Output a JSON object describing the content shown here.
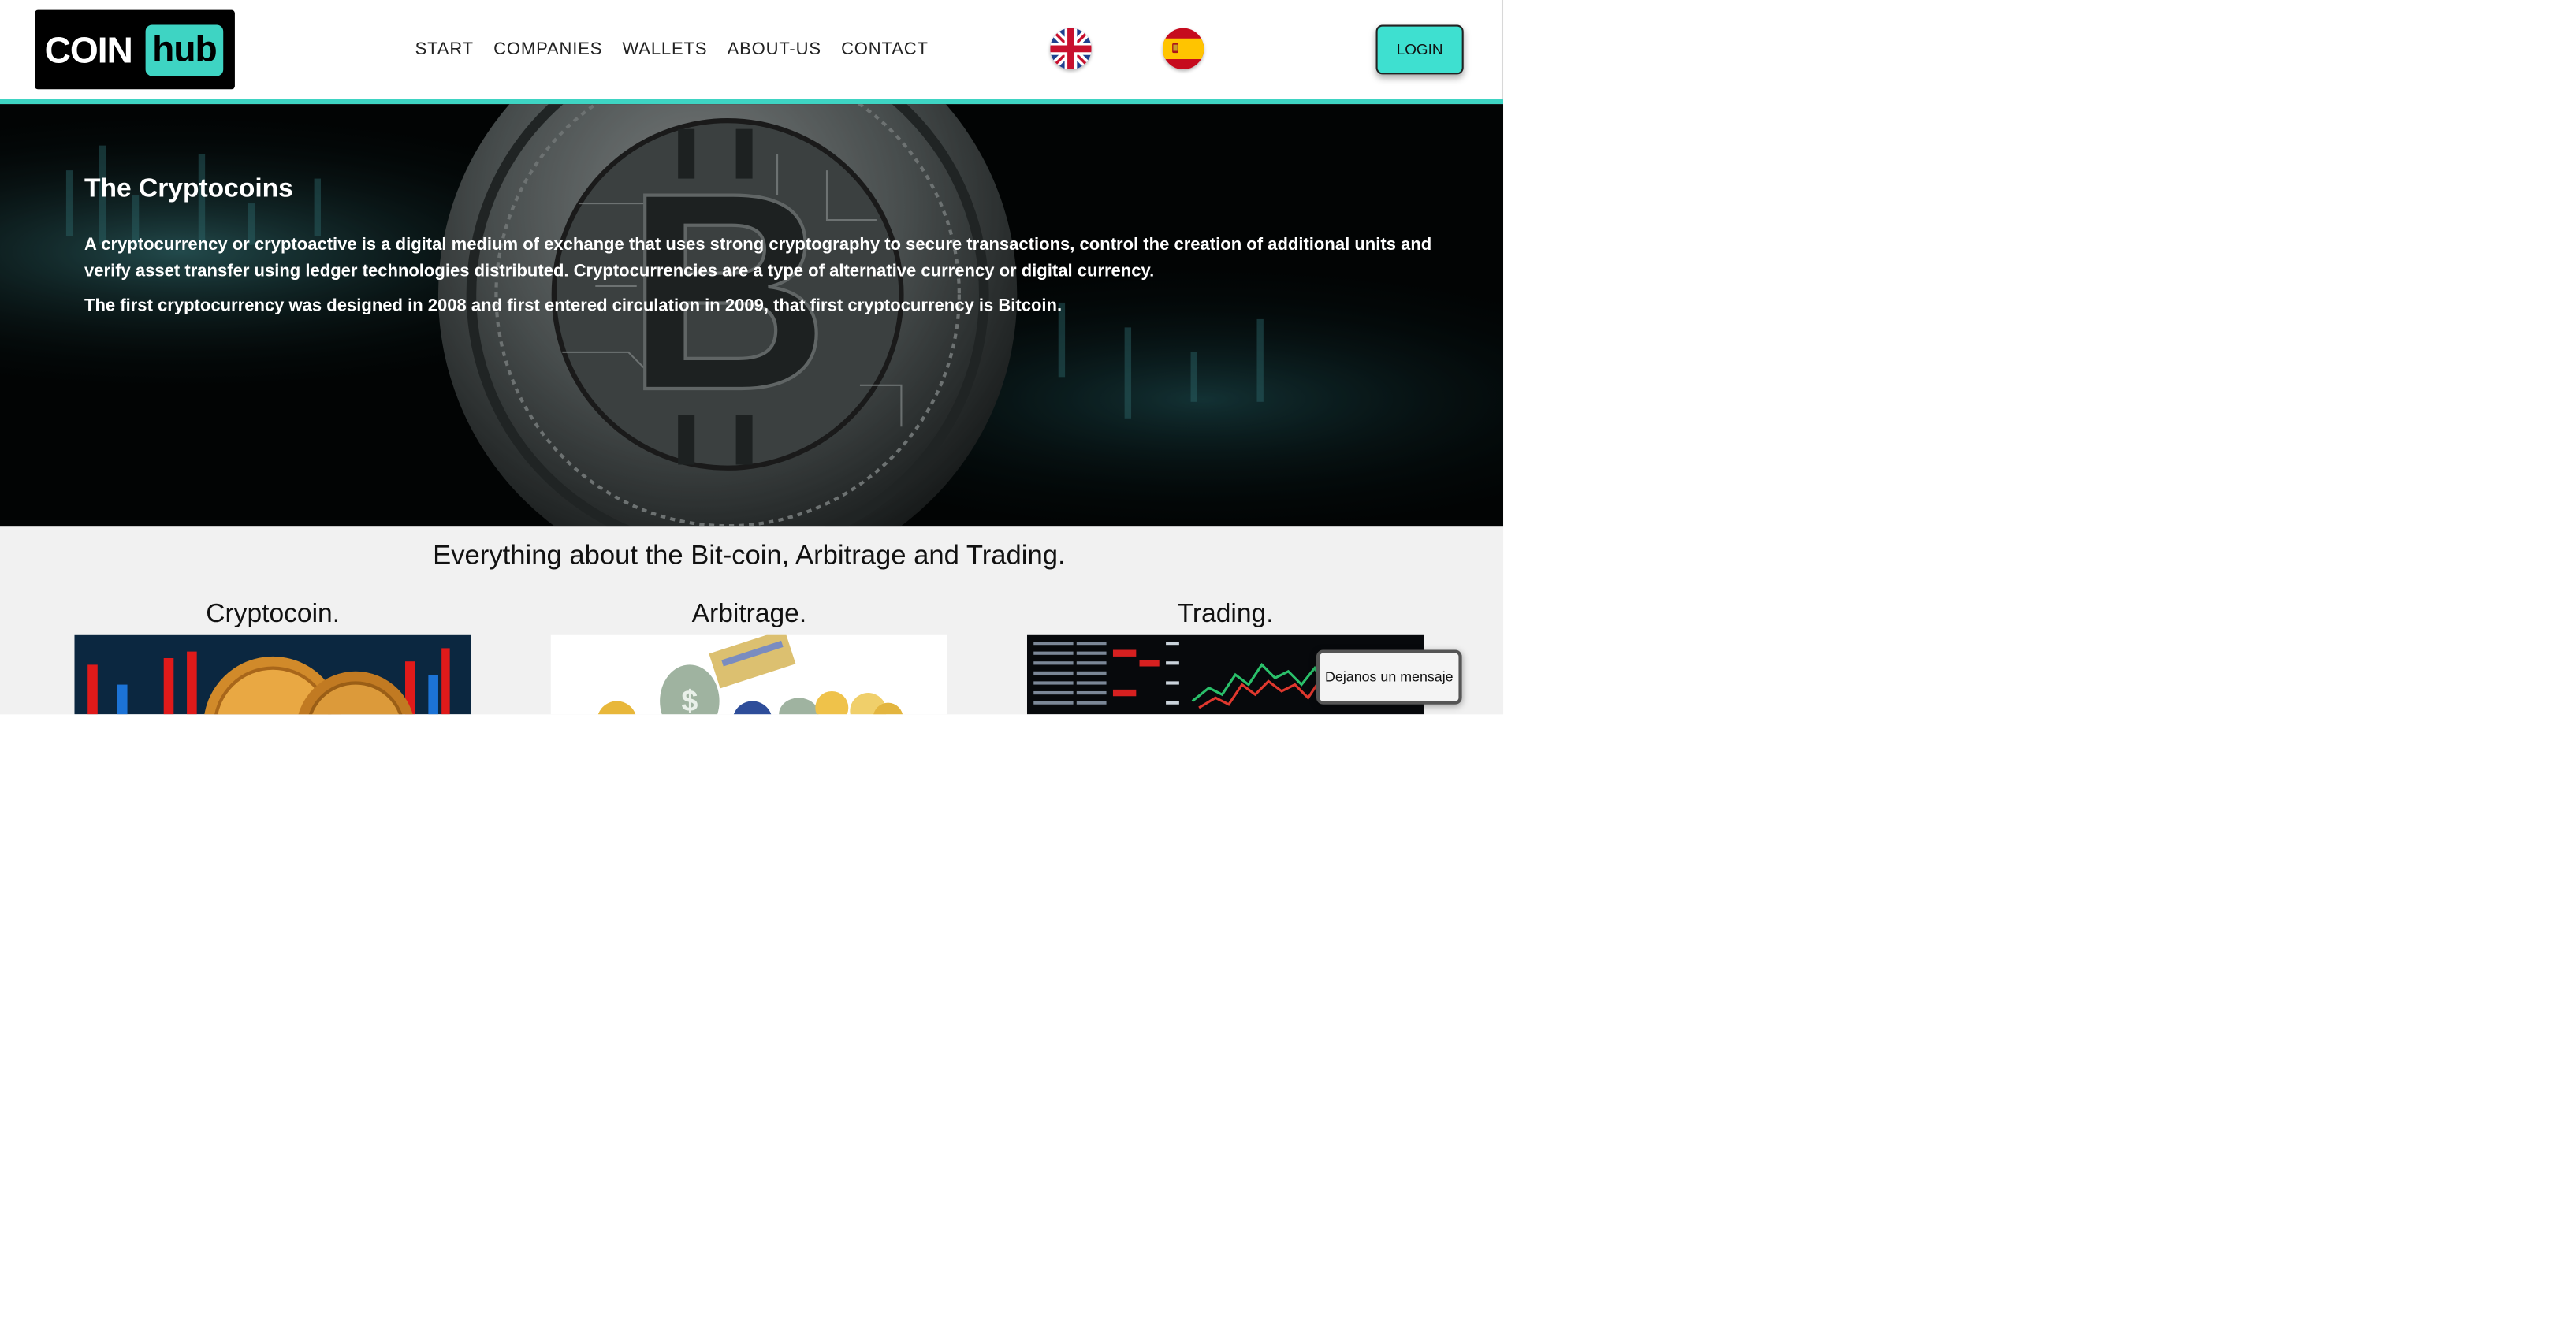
{
  "brand": {
    "coin": "COIN",
    "hub": "hub"
  },
  "nav": {
    "items": [
      {
        "label": "START"
      },
      {
        "label": "COMPANIES"
      },
      {
        "label": "WALLETS"
      },
      {
        "label": "ABOUT-US"
      },
      {
        "label": "CONTACT"
      }
    ]
  },
  "languages": {
    "uk_icon": "uk-flag-icon",
    "es_icon": "spain-flag-icon"
  },
  "header": {
    "login_label": "LOGIN"
  },
  "hero": {
    "title": "The Cryptocoins",
    "paragraph1": "A cryptocurrency or cryptoactive is a digital medium of exchange that uses strong cryptography to secure transactions, control the creation of additional units and verify asset transfer using ledger technologies distributed. Cryptocurrencies are a type of alternative currency or digital currency.",
    "paragraph2": "The first cryptocurrency was designed in 2008 and first entered circulation in 2009, that first cryptocurrency is Bitcoin."
  },
  "section": {
    "title": "Everything about the Bit-coin, Arbitrage and Trading.",
    "cards": [
      {
        "title": "Cryptocoin."
      },
      {
        "title": "Arbitrage."
      },
      {
        "title": "Trading."
      }
    ]
  },
  "chat": {
    "label": "Dejanos un mensaje"
  },
  "colors": {
    "accent": "#3ed4c3",
    "login_bg": "#3ee0d0",
    "section_bg": "#f1f1f1",
    "hero_bg": "#000000"
  }
}
